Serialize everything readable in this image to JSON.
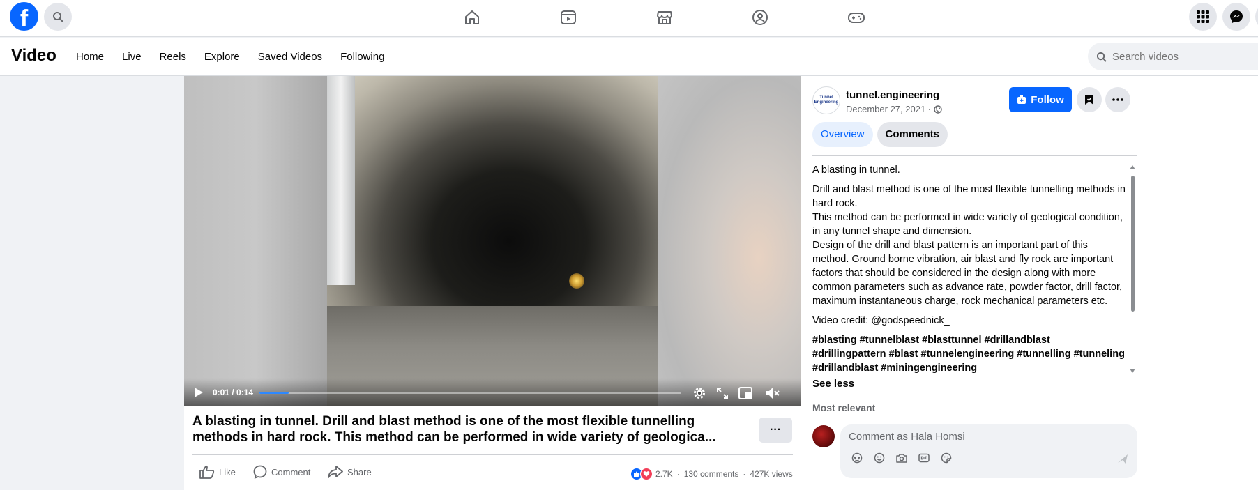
{
  "nav": {
    "logo_letter": "f",
    "icons": [
      "home-icon",
      "video-icon",
      "marketplace-icon",
      "groups-icon",
      "gaming-icon"
    ]
  },
  "subheader": {
    "title": "Video",
    "tabs": [
      "Home",
      "Live",
      "Reels",
      "Explore",
      "Saved Videos",
      "Following"
    ],
    "search_placeholder": "Search videos"
  },
  "player": {
    "time": "0:01 / 0:14",
    "progress": 0.07
  },
  "post": {
    "title_line1": "A blasting in tunnel. Drill and blast method is one of the most flexible tunnelling",
    "title_line2": "methods in hard rock. This method can be performed in wide variety of geologica...",
    "more": "···",
    "actions": {
      "like": "Like",
      "comment": "Comment",
      "share": "Share"
    },
    "reactions_count": "2.7K",
    "comments_count": "130 comments",
    "views": "427K views",
    "separator": "·"
  },
  "side": {
    "author": "tunnel.engineering",
    "avatar_text": "Tunnel Engineering",
    "date": "December 27, 2021 ·",
    "follow": "Follow",
    "tabs": {
      "overview": "Overview",
      "comments": "Comments"
    },
    "description": {
      "p1": "A blasting in tunnel.",
      "p2": "Drill and blast method is one of the most flexible tunnelling methods in hard rock.",
      "p3": "This method can be performed in wide variety of geological condition, in any tunnel shape and dimension.",
      "p4": "Design of the drill and blast pattern is an important part of this method. Ground borne vibration, air blast and fly rock are important factors that should be considered in the design along with more common parameters such as advance rate, powder factor, drill factor, maximum instantaneous charge, rock mechanical parameters etc.",
      "p5": "Video credit: @godspeednick_",
      "p6": "#blasting #tunnelblast #blasttunnel #drillandblast #drillingpattern #blast #tunnelengineering #tunnelling #tunneling #drillandblast #miningengineering"
    },
    "see_less": "See less",
    "most_relevant": "Most relevant",
    "comment_placeholder": "Comment as Hala Homsi"
  }
}
